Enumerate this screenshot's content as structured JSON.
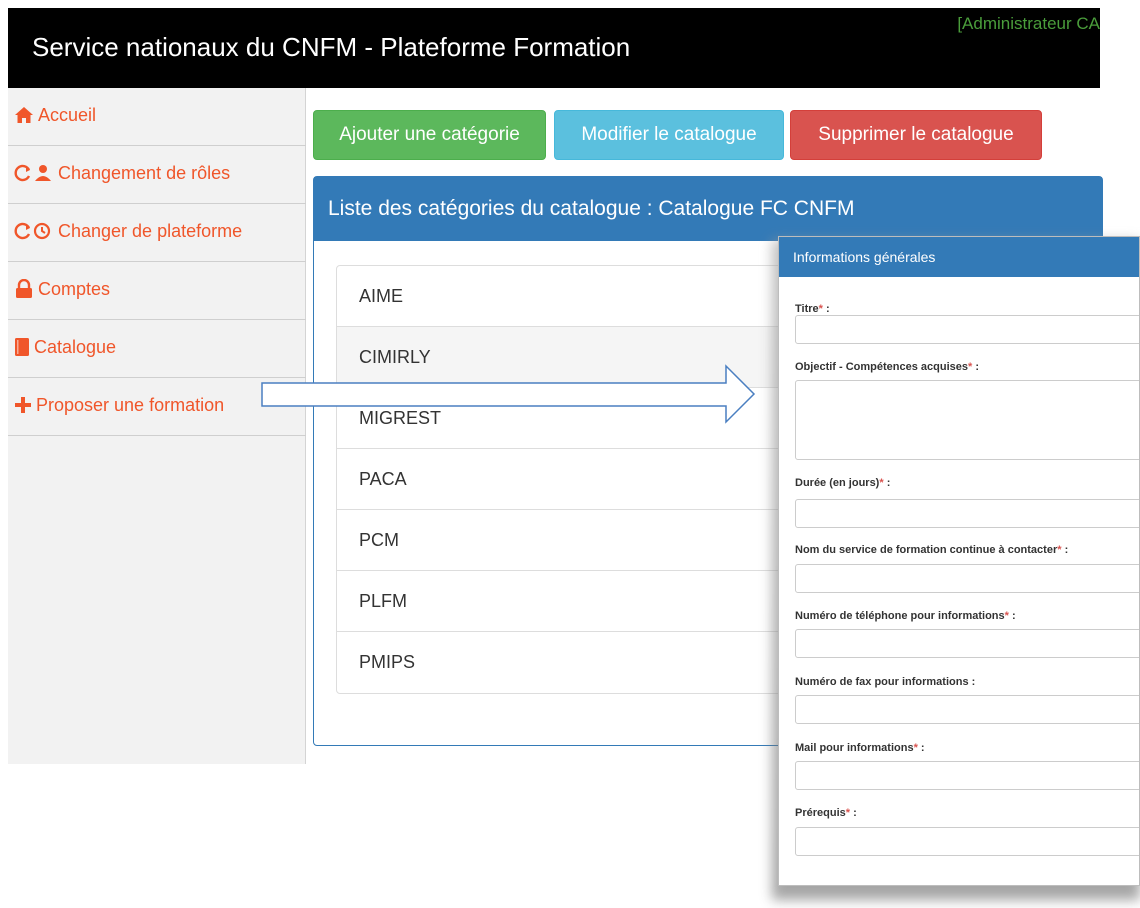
{
  "header": {
    "title": "Service nationaux du CNFM - Plateforme Formation",
    "user": "[Administrateur CA"
  },
  "sidebar": {
    "items": [
      {
        "label": "Accueil",
        "icon": "home-icon"
      },
      {
        "label": "Changement de rôles",
        "icon": "switch-user-icon"
      },
      {
        "label": "Changer de plateforme",
        "icon": "switch-platform-icon"
      },
      {
        "label": "Comptes",
        "icon": "lock-icon"
      },
      {
        "label": "Catalogue",
        "icon": "book-icon"
      },
      {
        "label": "Proposer une formation",
        "icon": "plus-icon"
      }
    ]
  },
  "toolbar": {
    "add_label": "Ajouter une catégorie",
    "edit_label": "Modifier le catalogue",
    "delete_label": "Supprimer le catalogue"
  },
  "panel": {
    "title": "Liste des catégories du catalogue : Catalogue FC CNFM",
    "categories": [
      "AIME",
      "CIMIRLY",
      "MIGREST",
      "PACA",
      "PCM",
      "PLFM",
      "PMIPS"
    ]
  },
  "form": {
    "header": "Informations générales",
    "fields": [
      {
        "label": "Titre",
        "required": "*",
        "suffix": " :"
      },
      {
        "label": "Objectif - Compétences acquises",
        "required": "*",
        "suffix": " :"
      },
      {
        "label": "Durée (en jours)",
        "required": "*",
        "suffix": " :"
      },
      {
        "label": "Nom du service de formation continue à contacter",
        "required": "*",
        "suffix": " :"
      },
      {
        "label": "Numéro de téléphone pour informations",
        "required": "*",
        "suffix": " :"
      },
      {
        "label": "Numéro de fax pour informations :",
        "required": "",
        "suffix": ""
      },
      {
        "label": "Mail pour informations",
        "required": "*",
        "suffix": " :"
      },
      {
        "label": "Prérequis",
        "required": "*",
        "suffix": " :"
      }
    ]
  },
  "colors": {
    "header_bg": "#000000",
    "accent": "#337ab7",
    "nav_text": "#f0562a",
    "success": "#5cb85c",
    "info": "#5bc0de",
    "danger": "#d9534f"
  }
}
